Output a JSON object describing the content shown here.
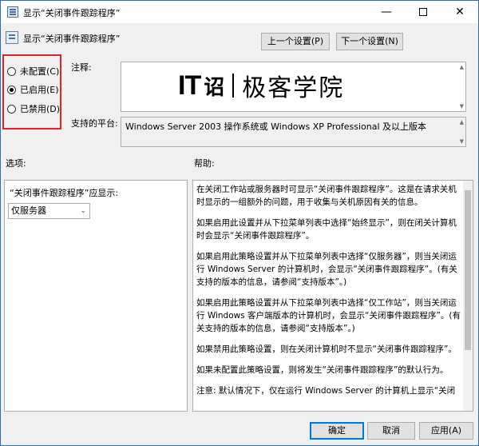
{
  "window": {
    "title": "显示“关闭事件跟踪程序”",
    "min_glyph": "—",
    "close_glyph": "✕"
  },
  "header": {
    "policy_name": "显示“关闭事件跟踪程序”",
    "prev_button": "上一个设置(P)",
    "next_button": "下一个设置(N)"
  },
  "state": {
    "options": [
      {
        "label": "未配置(C)",
        "selected": false
      },
      {
        "label": "已启用(E)",
        "selected": true
      },
      {
        "label": "已禁用(D)",
        "selected": false
      }
    ]
  },
  "labels": {
    "comment": "注释:",
    "supported_on": "支持的平台:",
    "options": "选项:",
    "help": "帮助:"
  },
  "comment": {
    "logo_it": "IT",
    "logo_mark": "诏",
    "logo_cn": "极客学院"
  },
  "supported_on": {
    "value": "Windows Server 2003 操作系统或 Windows XP Professional 及以上版本"
  },
  "options_panel": {
    "field_label": "“关闭事件跟踪程序”应显示:",
    "select_value": "仅服务器"
  },
  "help_panel": {
    "paragraphs": [
      "在关闭工作站或服务器时可显示“关闭事件跟踪程序”。这是在请求关机时显示的一组额外的问题，用于收集与关机原因有关的信息。",
      "如果启用此设置并从下拉菜单列表中选择“始终显示”，则在闭关计算机时会显示“关闭事件跟踪程序”。",
      "如果启用此策略设置并从下拉菜单列表中选择“仅服务器”，则当关闭运行 Windows Server 的计算机时，会显示“关闭事件跟踪程序”。(有关支持的版本的信息，请参阅“支持版本”。)",
      "如果启用此策略设置并从下拉菜单列表中选择“仅工作站”，则当关闭运行 Windows 客户端版本的计算机时，会显示“关闭事件跟踪程序”。(有关支持的版本的信息，请参阅“支持版本”。)",
      "如果禁用此策略设置，则在关闭计算机时不显示“关闭事件跟踪程序”。",
      "如果未配置此策略设置，则将发生“关闭事件跟踪程序”的默认行为。",
      "注意: 默认情况下，仅在运行 Windows Server 的计算机上显示“关闭"
    ]
  },
  "footer": {
    "ok": "确定",
    "cancel": "取消",
    "apply": "应用(A)"
  }
}
